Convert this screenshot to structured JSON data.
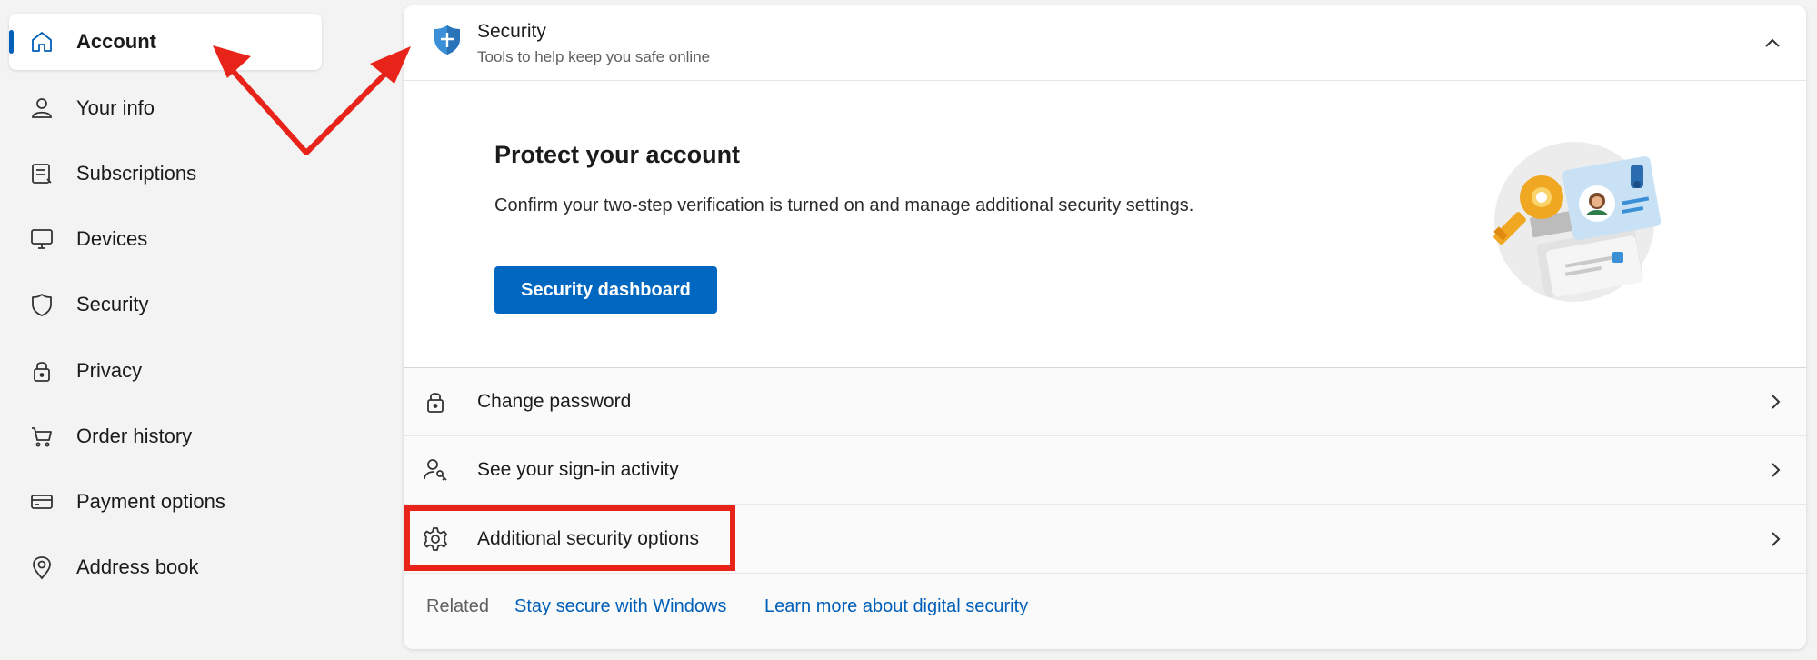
{
  "sidebar": {
    "items": [
      {
        "label": "Account",
        "icon": "home-icon",
        "active": true
      },
      {
        "label": "Your info",
        "icon": "person-icon"
      },
      {
        "label": "Subscriptions",
        "icon": "subscriptions-icon"
      },
      {
        "label": "Devices",
        "icon": "monitor-icon"
      },
      {
        "label": "Security",
        "icon": "shield-icon"
      },
      {
        "label": "Privacy",
        "icon": "lock-icon"
      },
      {
        "label": "Order history",
        "icon": "cart-icon"
      },
      {
        "label": "Payment options",
        "icon": "card-icon"
      },
      {
        "label": "Address book",
        "icon": "location-pin-icon"
      }
    ]
  },
  "security_card": {
    "title": "Security",
    "subtitle": "Tools to help keep you safe online",
    "hero": {
      "title": "Protect your account",
      "description": "Confirm your two-step verification is turned on and manage additional security settings.",
      "button_label": "Security dashboard"
    },
    "rows": [
      {
        "label": "Change password",
        "icon": "lock-icon"
      },
      {
        "label": "See your sign-in activity",
        "icon": "person-key-icon"
      },
      {
        "label": "Additional security options",
        "icon": "gear-icon"
      }
    ],
    "related": {
      "label": "Related",
      "links": [
        "Stay secure with Windows",
        "Learn more about digital security"
      ]
    }
  },
  "colors": {
    "accent": "#0067c0",
    "link": "#005fb8",
    "annotation": "#e8231a",
    "background": "#f3f3f3"
  }
}
